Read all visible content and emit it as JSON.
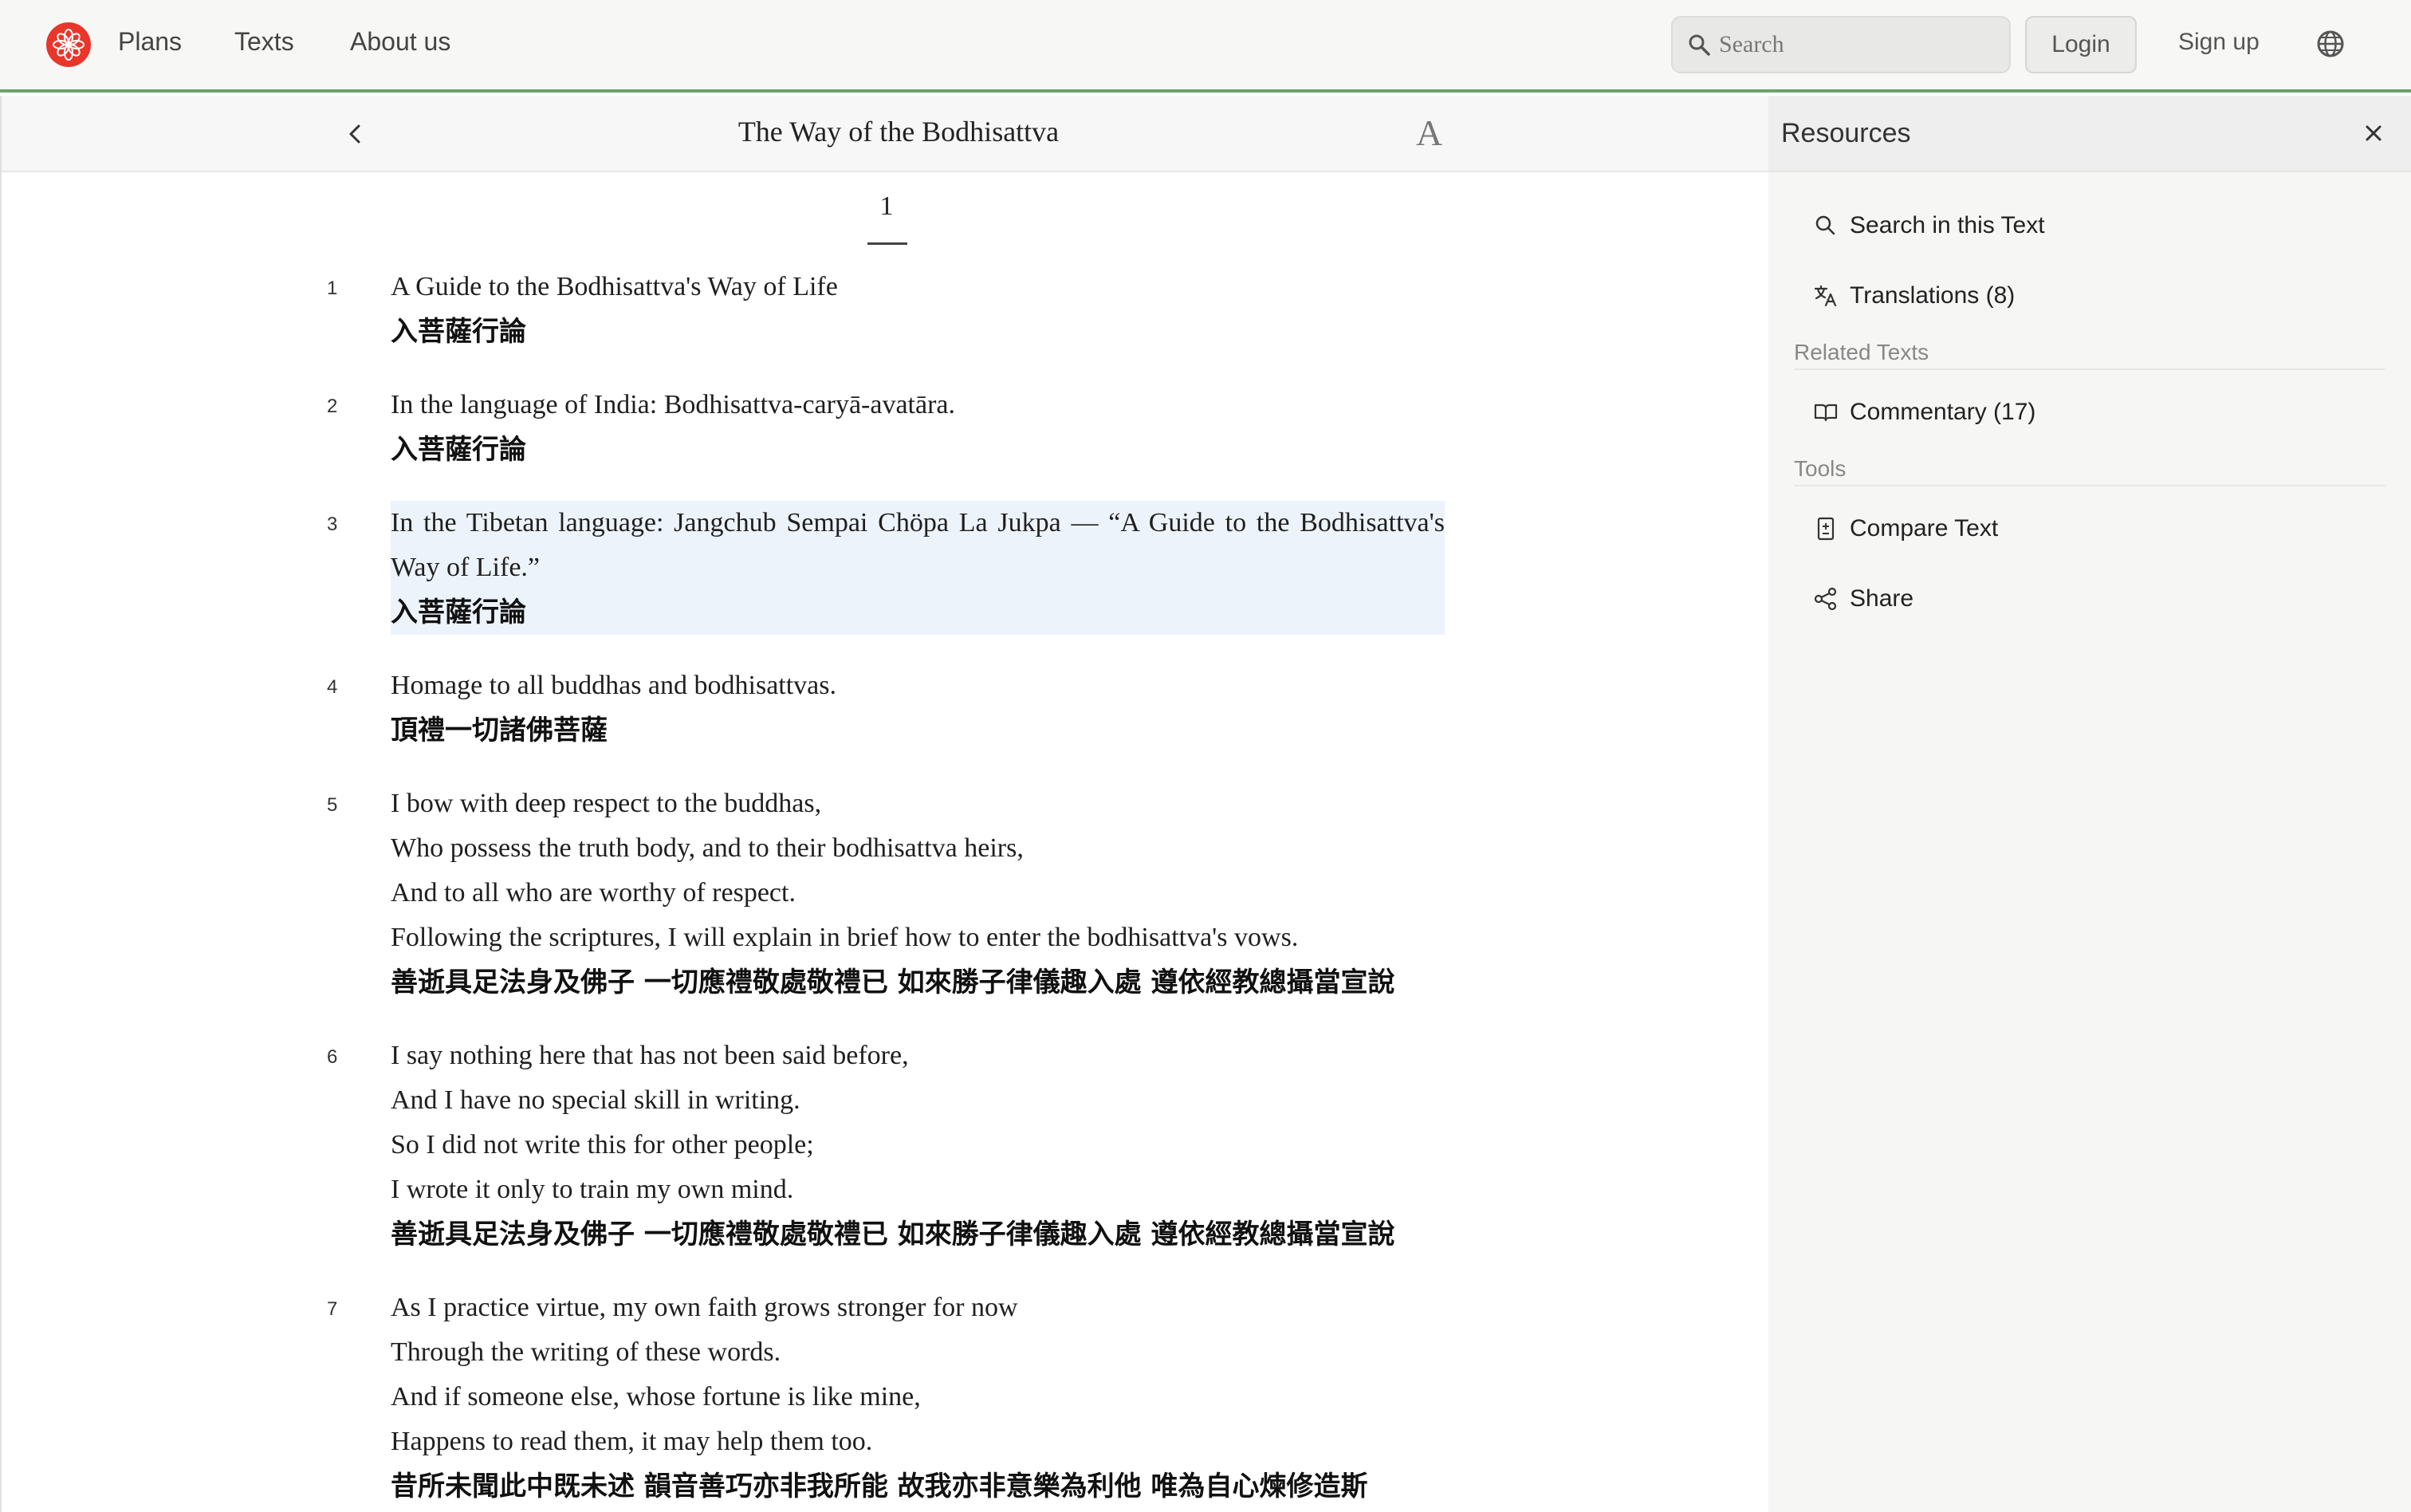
{
  "nav": {
    "links": [
      "Plans",
      "Texts",
      "About us"
    ],
    "search_placeholder": "Search",
    "login_label": "Login",
    "signup_label": "Sign up",
    "accent_color": "#e8362b"
  },
  "reader": {
    "title": "The Way of the Bodhisattva",
    "font_button": "A",
    "chapter": "1",
    "verses": [
      {
        "num": "1",
        "en": [
          "A Guide to the Bodhisattva's Way of Life"
        ],
        "zh": [
          "入菩薩行論"
        ]
      },
      {
        "num": "2",
        "en": [
          "In the language of India: Bodhisattva-caryā-avatāra."
        ],
        "zh": [
          "入菩薩行論"
        ]
      },
      {
        "num": "3",
        "en": [
          "In the Tibetan language: Jangchub Sempai Chöpa La Jukpa — “A Guide to the Bodhisattva's Way of Life.”"
        ],
        "zh": [
          "入菩薩行論"
        ],
        "highlight": true
      },
      {
        "num": "4",
        "en": [
          "Homage to all buddhas and bodhisattvas."
        ],
        "zh": [
          "頂禮一切諸佛菩薩"
        ]
      },
      {
        "num": "5",
        "en": [
          "I bow with deep respect to the buddhas,",
          "Who possess the truth body, and to their bodhisattva heirs,",
          "And to all who are worthy of respect.",
          "Following the scriptures, I will explain in brief how to enter the bodhisattva's vows."
        ],
        "zh": [
          "善逝具足法身及佛子 一切應禮敬處敬禮已 如來勝子律儀趣入處 遵依經教總攝當宣說"
        ]
      },
      {
        "num": "6",
        "en": [
          "I say nothing here that has not been said before,",
          "And I have no special skill in writing.",
          "So I did not write this for other people;",
          "I wrote it only to train my own mind."
        ],
        "zh": [
          "善逝具足法身及佛子 一切應禮敬處敬禮已 如來勝子律儀趣入處 遵依經教總攝當宣說"
        ]
      },
      {
        "num": "7",
        "en": [
          "As I practice virtue, my own faith grows stronger for now",
          "Through the writing of these words.",
          "And if someone else, whose fortune is like mine,",
          "Happens to read them, it may help them too."
        ],
        "zh": [
          "昔所未聞此中既未述 韻音善巧亦非我所能 故我亦非意樂為利他 唯為自心煉修造斯"
        ]
      }
    ]
  },
  "resources": {
    "title": "Resources",
    "search_label": "Search in this Text",
    "translations_label": "Translations (8)",
    "related_heading": "Related Texts",
    "commentary_label": "Commentary (17)",
    "tools_heading": "Tools",
    "compare_label": "Compare Text",
    "share_label": "Share"
  }
}
